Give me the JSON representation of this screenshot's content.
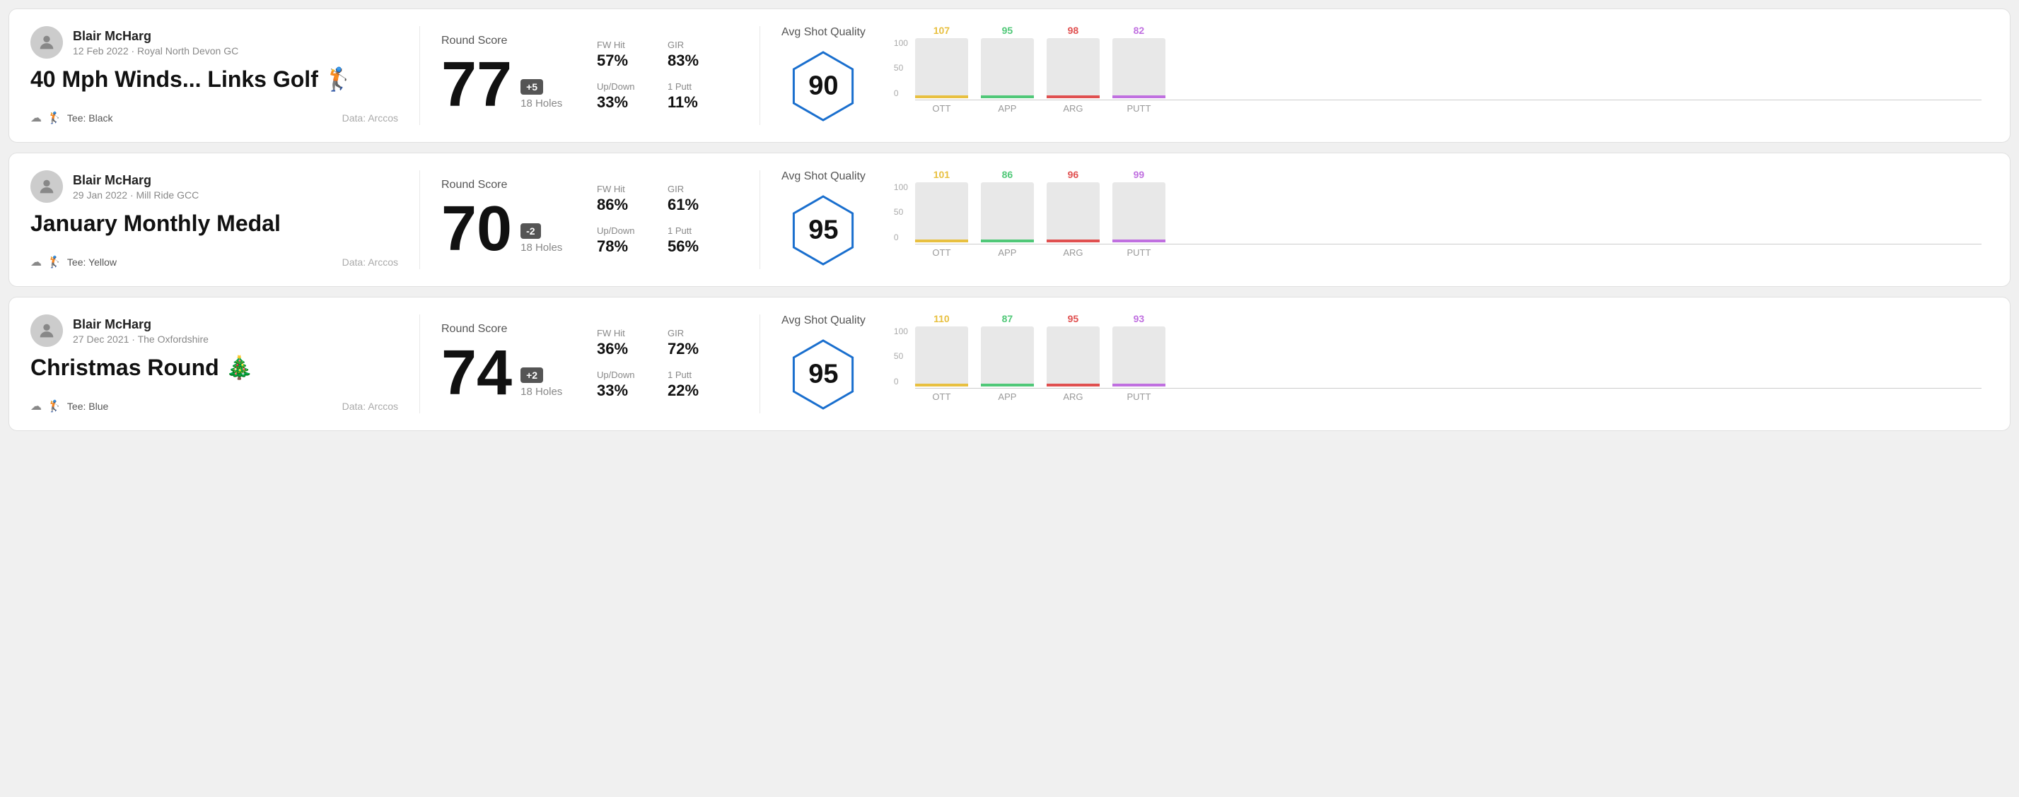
{
  "rounds": [
    {
      "id": "round1",
      "user_name": "Blair McHarg",
      "user_meta": "12 Feb 2022 · Royal North Devon GC",
      "round_title": "40 Mph Winds... Links Golf 🏌",
      "tee": "Tee: Black",
      "data_source": "Data: Arccos",
      "score": "77",
      "score_diff": "+5",
      "holes": "18 Holes",
      "fw_hit": "57%",
      "gir": "83%",
      "up_down": "33%",
      "one_putt": "11%",
      "avg_shot_quality": "90",
      "chart": {
        "ott": {
          "val": 107,
          "color": "#e8c040",
          "pct": 75
        },
        "app": {
          "val": 95,
          "color": "#50c878",
          "pct": 65
        },
        "arg": {
          "val": 98,
          "color": "#e05050",
          "pct": 68
        },
        "putt": {
          "val": 82,
          "color": "#c070e0",
          "pct": 56
        }
      }
    },
    {
      "id": "round2",
      "user_name": "Blair McHarg",
      "user_meta": "29 Jan 2022 · Mill Ride GCC",
      "round_title": "January Monthly Medal",
      "tee": "Tee: Yellow",
      "data_source": "Data: Arccos",
      "score": "70",
      "score_diff": "-2",
      "holes": "18 Holes",
      "fw_hit": "86%",
      "gir": "61%",
      "up_down": "78%",
      "one_putt": "56%",
      "avg_shot_quality": "95",
      "chart": {
        "ott": {
          "val": 101,
          "color": "#e8c040",
          "pct": 72
        },
        "app": {
          "val": 86,
          "color": "#50c878",
          "pct": 60
        },
        "arg": {
          "val": 96,
          "color": "#e05050",
          "pct": 67
        },
        "putt": {
          "val": 99,
          "color": "#c070e0",
          "pct": 70
        }
      }
    },
    {
      "id": "round3",
      "user_name": "Blair McHarg",
      "user_meta": "27 Dec 2021 · The Oxfordshire",
      "round_title": "Christmas Round 🎄",
      "tee": "Tee: Blue",
      "data_source": "Data: Arccos",
      "score": "74",
      "score_diff": "+2",
      "holes": "18 Holes",
      "fw_hit": "36%",
      "gir": "72%",
      "up_down": "33%",
      "one_putt": "22%",
      "avg_shot_quality": "95",
      "chart": {
        "ott": {
          "val": 110,
          "color": "#e8c040",
          "pct": 78
        },
        "app": {
          "val": 87,
          "color": "#50c878",
          "pct": 61
        },
        "arg": {
          "val": 95,
          "color": "#e05050",
          "pct": 66
        },
        "putt": {
          "val": 93,
          "color": "#c070e0",
          "pct": 65
        }
      }
    }
  ],
  "labels": {
    "round_score": "Round Score",
    "fw_hit": "FW Hit",
    "gir": "GIR",
    "up_down": "Up/Down",
    "one_putt": "1 Putt",
    "avg_shot_quality": "Avg Shot Quality",
    "ott": "OTT",
    "app": "APP",
    "arg": "ARG",
    "putt": "PUTT",
    "data_arccos": "Data: Arccos",
    "y100": "100",
    "y50": "50",
    "y0": "0"
  }
}
